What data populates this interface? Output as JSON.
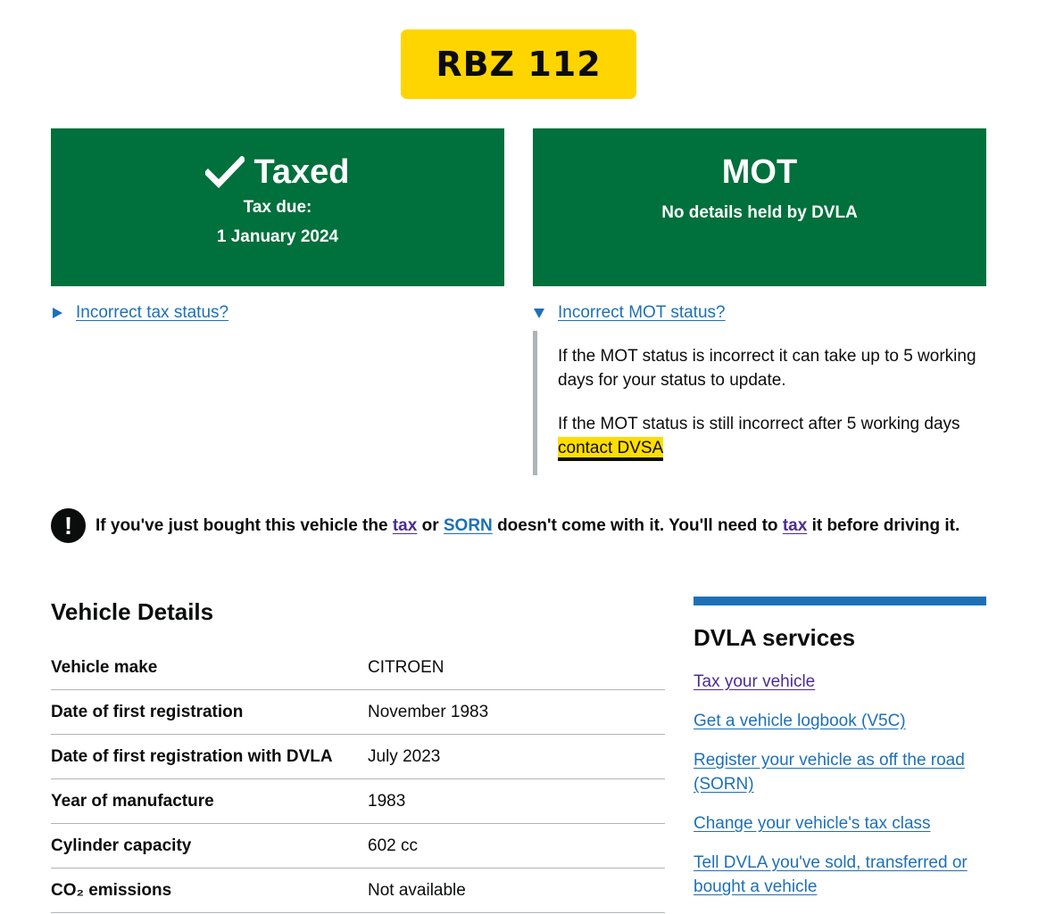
{
  "plate": {
    "registration": "RBZ 112"
  },
  "tax_panel": {
    "heading": "Taxed",
    "due_label": "Tax due:",
    "due_date": "1 January 2024"
  },
  "mot_panel": {
    "heading": "MOT",
    "status": "No details held by DVLA"
  },
  "tax_details": {
    "summary": "Incorrect tax status?"
  },
  "mot_details": {
    "summary": "Incorrect MOT status?",
    "para1": "If the MOT status is incorrect it can take up to 5 working days for your status to update.",
    "para2_prefix": "If the MOT status is still incorrect after 5 working days",
    "para2_link": "contact DVSA"
  },
  "warning": {
    "part1": "If you've just bought this vehicle the",
    "link_tax": "tax",
    "part2": "or",
    "link_sorn": "SORN",
    "part3": "doesn't come with it. You'll need to",
    "link_tax2": "tax",
    "part4": "it before driving it."
  },
  "vehicle_details": {
    "title": "Vehicle Details",
    "rows": [
      {
        "key": "Vehicle make",
        "value": "CITROEN"
      },
      {
        "key": "Date of first registration",
        "value": "November 1983"
      },
      {
        "key": "Date of first registration with DVLA",
        "value": "July 2023"
      },
      {
        "key": "Year of manufacture",
        "value": "1983"
      },
      {
        "key": "Cylinder capacity",
        "value": "602 cc"
      },
      {
        "key": "CO₂ emissions",
        "value": "Not available"
      }
    ]
  },
  "dvla_services": {
    "title": "DVLA services",
    "links": [
      "Tax your vehicle",
      "Get a vehicle logbook (V5C)",
      "Register your vehicle as off the road (SORN)",
      "Change your vehicle's tax class",
      "Tell DVLA you've sold, transferred or bought a vehicle"
    ]
  }
}
